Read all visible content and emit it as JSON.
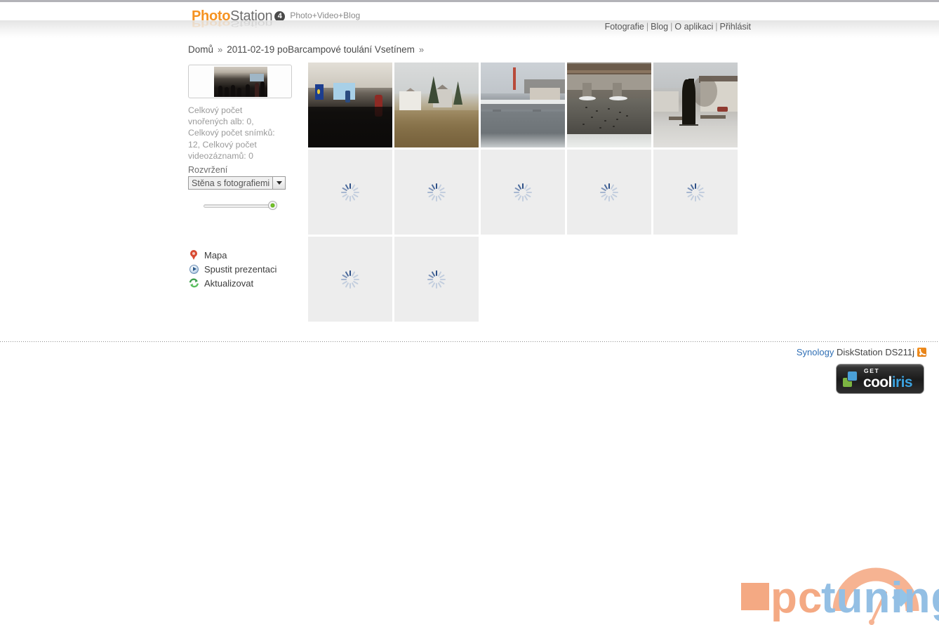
{
  "header": {
    "logo_photo": "Photo",
    "logo_station": "Station",
    "logo_version": "4",
    "tagline": "Photo+Video+Blog"
  },
  "topnav": {
    "items": [
      {
        "label": "Fotografie"
      },
      {
        "label": "Blog"
      },
      {
        "label": "O aplikaci"
      },
      {
        "label": "Přihlásit"
      }
    ],
    "separator": "|"
  },
  "breadcrumb": {
    "home": "Domů",
    "arrow": "»",
    "album": "2011-02-19 poBarcampové toulání Vsetínem",
    "trailing_arrow": "»"
  },
  "sidebar": {
    "stats": "Celkový počet vnořených alb: 0, Celkový počet snímků: 12, Celkový počet videozáznamů: 0",
    "layout_label": "Rozvržení",
    "layout_value": "Stěna s fotografiemi",
    "slider": {
      "small_icon": "person-small-icon",
      "large_icon": "person-large-icon",
      "value": 100
    },
    "actions": [
      {
        "label": "Mapa",
        "icon": "map-pin-icon"
      },
      {
        "label": "Spustit prezentaci",
        "icon": "play-circle-icon"
      },
      {
        "label": "Aktualizovat",
        "icon": "refresh-icon"
      }
    ]
  },
  "grid": {
    "columns": 5,
    "photos": [
      {
        "id": 1,
        "state": "loaded",
        "alt": "Přednáška v sále s projekcí"
      },
      {
        "id": 2,
        "state": "loaded",
        "alt": "Domy a stromy za zimního dne"
      },
      {
        "id": 3,
        "state": "loaded",
        "alt": "Most přes řeku s budovou v pozadí"
      },
      {
        "id": 4,
        "state": "loaded",
        "alt": "Most s kachnami na řece"
      },
      {
        "id": 5,
        "state": "loaded",
        "alt": "Černá socha na náměstí"
      },
      {
        "id": 6,
        "state": "loading"
      },
      {
        "id": 7,
        "state": "loading"
      },
      {
        "id": 8,
        "state": "loading"
      },
      {
        "id": 9,
        "state": "loading"
      },
      {
        "id": 10,
        "state": "loading"
      },
      {
        "id": 11,
        "state": "loading"
      },
      {
        "id": 12,
        "state": "loading"
      }
    ]
  },
  "footer": {
    "brand_link": "Synology",
    "device": "DiskStation DS211j",
    "rss_icon": "rss-icon"
  },
  "cooliris": {
    "get": "GET",
    "cool": "cool",
    "iris": "iris"
  },
  "watermark": {
    "pc": "pc",
    "tuning": "tuning"
  },
  "colors": {
    "accent_orange": "#f59322",
    "link_blue": "#2f6fb5",
    "tile_placeholder": "#ededed",
    "spinner_blue": "#2d4f86",
    "watermark_salmon": "#f4a983",
    "watermark_blue": "#93bfe4"
  }
}
